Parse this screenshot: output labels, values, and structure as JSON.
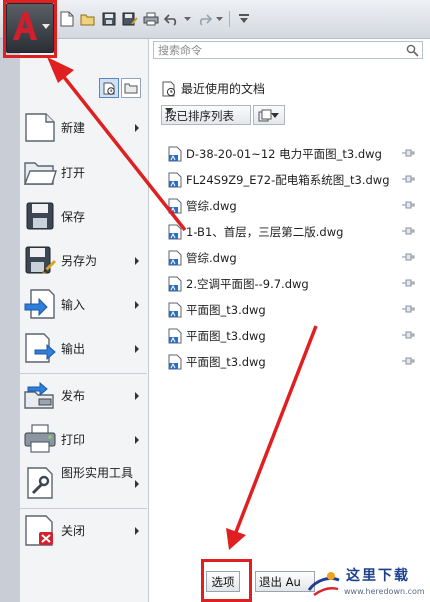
{
  "search": {
    "placeholder": "搜索命令"
  },
  "nav": {
    "items": [
      {
        "label": "新建",
        "icon": "new-document-icon",
        "submenu": true
      },
      {
        "label": "打开",
        "icon": "open-folder-icon",
        "submenu": false
      },
      {
        "label": "保存",
        "icon": "floppy-disk-icon",
        "submenu": false
      },
      {
        "label": "另存为",
        "icon": "save-as-icon",
        "submenu": true
      },
      {
        "label": "输入",
        "icon": "import-icon",
        "submenu": true
      },
      {
        "label": "输出",
        "icon": "export-icon",
        "submenu": true
      },
      {
        "label": "发布",
        "icon": "publish-icon",
        "submenu": true
      },
      {
        "label": "打印",
        "icon": "printer-icon",
        "submenu": true
      },
      {
        "label": "图形实用工具",
        "icon": "wrench-icon",
        "submenu": true
      },
      {
        "label": "关闭",
        "icon": "close-document-icon",
        "submenu": true
      }
    ]
  },
  "recent": {
    "title": "最近使用的文档",
    "sort_label": "按已排序列表",
    "files": [
      "D-38-20-01~12 电力平面图_t3.dwg",
      "FL24S9Z9_E72-配电箱系统图_t3.dwg",
      "管综.dwg",
      "1-B1、首层，三层第二版.dwg",
      "管综.dwg",
      "2.空调平面图--9.7.dwg",
      "平面图_t3.dwg",
      "平面图_t3.dwg",
      "平面图_t3.dwg"
    ]
  },
  "buttons": {
    "options": "选项",
    "exit": "退出 Au"
  },
  "watermark": {
    "text": "这里下载",
    "url": "www.heredown.com"
  },
  "colors": {
    "highlight": "#e02020",
    "app_red": "#c8102e",
    "brand_blue": "#1d3f8e"
  }
}
